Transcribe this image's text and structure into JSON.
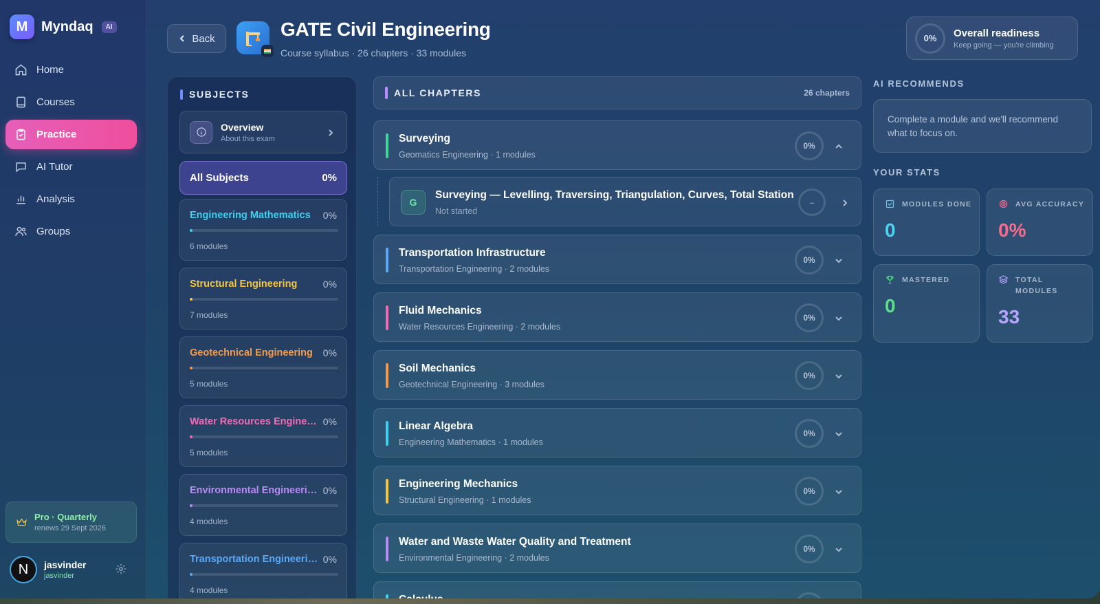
{
  "brand": {
    "name": "Myndaq",
    "logo_letter": "M",
    "badge": "AI"
  },
  "nav": [
    {
      "label": "Home",
      "icon": "home-icon"
    },
    {
      "label": "Courses",
      "icon": "book-icon"
    },
    {
      "label": "Practice",
      "icon": "clipboard-icon",
      "active": true
    },
    {
      "label": "AI Tutor",
      "icon": "chat-icon"
    },
    {
      "label": "Analysis",
      "icon": "bar-chart-icon"
    },
    {
      "label": "Groups",
      "icon": "users-icon"
    }
  ],
  "plan": {
    "title": "Pro · Quarterly",
    "renews": "renews 29 Sept 2026"
  },
  "user": {
    "name": "jasvinder",
    "handle": "jasvinder",
    "avatar_letter": "N"
  },
  "header": {
    "back_label": "Back",
    "title": "GATE Civil Engineering",
    "subtitle": "Course syllabus · 26 chapters · 33 modules",
    "readiness_pct": "0%",
    "readiness_title": "Overall readiness",
    "readiness_sub": "Keep going — you're climbing"
  },
  "subjects": {
    "label": "SUBJECTS",
    "overview_title": "Overview",
    "overview_sub": "About this exam",
    "all_label": "All Subjects",
    "all_pct": "0%",
    "items": [
      {
        "name": "Engineering Mathematics",
        "pct": "0%",
        "modules": "6 modules",
        "color": "#3fd0f0"
      },
      {
        "name": "Structural Engineering",
        "pct": "0%",
        "modules": "7 modules",
        "color": "#f5c542"
      },
      {
        "name": "Geotechnical Engineering",
        "pct": "0%",
        "modules": "5 modules",
        "color": "#f59a4a"
      },
      {
        "name": "Water Resources Engineering",
        "pct": "0%",
        "modules": "5 modules",
        "color": "#f06ab4"
      },
      {
        "name": "Environmental Engineering",
        "pct": "0%",
        "modules": "4 modules",
        "color": "#b88af5"
      },
      {
        "name": "Transportation Engineering",
        "pct": "0%",
        "modules": "4 modules",
        "color": "#5aa8f5"
      }
    ]
  },
  "chapters": {
    "label": "ALL CHAPTERS",
    "count": "26 chapters",
    "expanded_module": {
      "letter": "G",
      "title": "Surveying — Levelling, Traversing, Triangulation, Curves, Total Station",
      "status": "Not started",
      "progress": "–"
    },
    "items": [
      {
        "title": "Surveying",
        "sub": "Geomatics Engineering · 1 modules",
        "pct": "0%",
        "color": "#3fd89a",
        "expanded": true
      },
      {
        "title": "Transportation Infrastructure",
        "sub": "Transportation Engineering · 2 modules",
        "pct": "0%",
        "color": "#5aa8f5"
      },
      {
        "title": "Fluid Mechanics",
        "sub": "Water Resources Engineering · 2 modules",
        "pct": "0%",
        "color": "#f06ab4"
      },
      {
        "title": "Soil Mechanics",
        "sub": "Geotechnical Engineering · 3 modules",
        "pct": "0%",
        "color": "#f59a4a"
      },
      {
        "title": "Linear Algebra",
        "sub": "Engineering Mathematics · 1 modules",
        "pct": "0%",
        "color": "#3fd0f0"
      },
      {
        "title": "Engineering Mechanics",
        "sub": "Structural Engineering · 1 modules",
        "pct": "0%",
        "color": "#f5c542"
      },
      {
        "title": "Water and Waste Water Quality and Treatment",
        "sub": "Environmental Engineering · 2 modules",
        "pct": "0%",
        "color": "#b88af5"
      },
      {
        "title": "Calculus",
        "sub": "",
        "pct": "",
        "color": "#3fd0f0"
      }
    ]
  },
  "right": {
    "ai_label": "AI RECOMMENDS",
    "ai_text": "Complete a module and we'll recommend what to focus on.",
    "stats_label": "YOUR STATS",
    "stats": {
      "modules_done": {
        "label": "MODULES DONE",
        "value": "0",
        "color": "#4ad4f0"
      },
      "avg_accuracy": {
        "label": "AVG ACCURACY",
        "value": "0%",
        "color": "#f56b8a"
      },
      "mastered": {
        "label": "MASTERED",
        "value": "0",
        "color": "#5ae08a"
      },
      "total_modules": {
        "label": "TOTAL MODULES",
        "value": "33",
        "color": "#b8a4ff"
      }
    }
  }
}
